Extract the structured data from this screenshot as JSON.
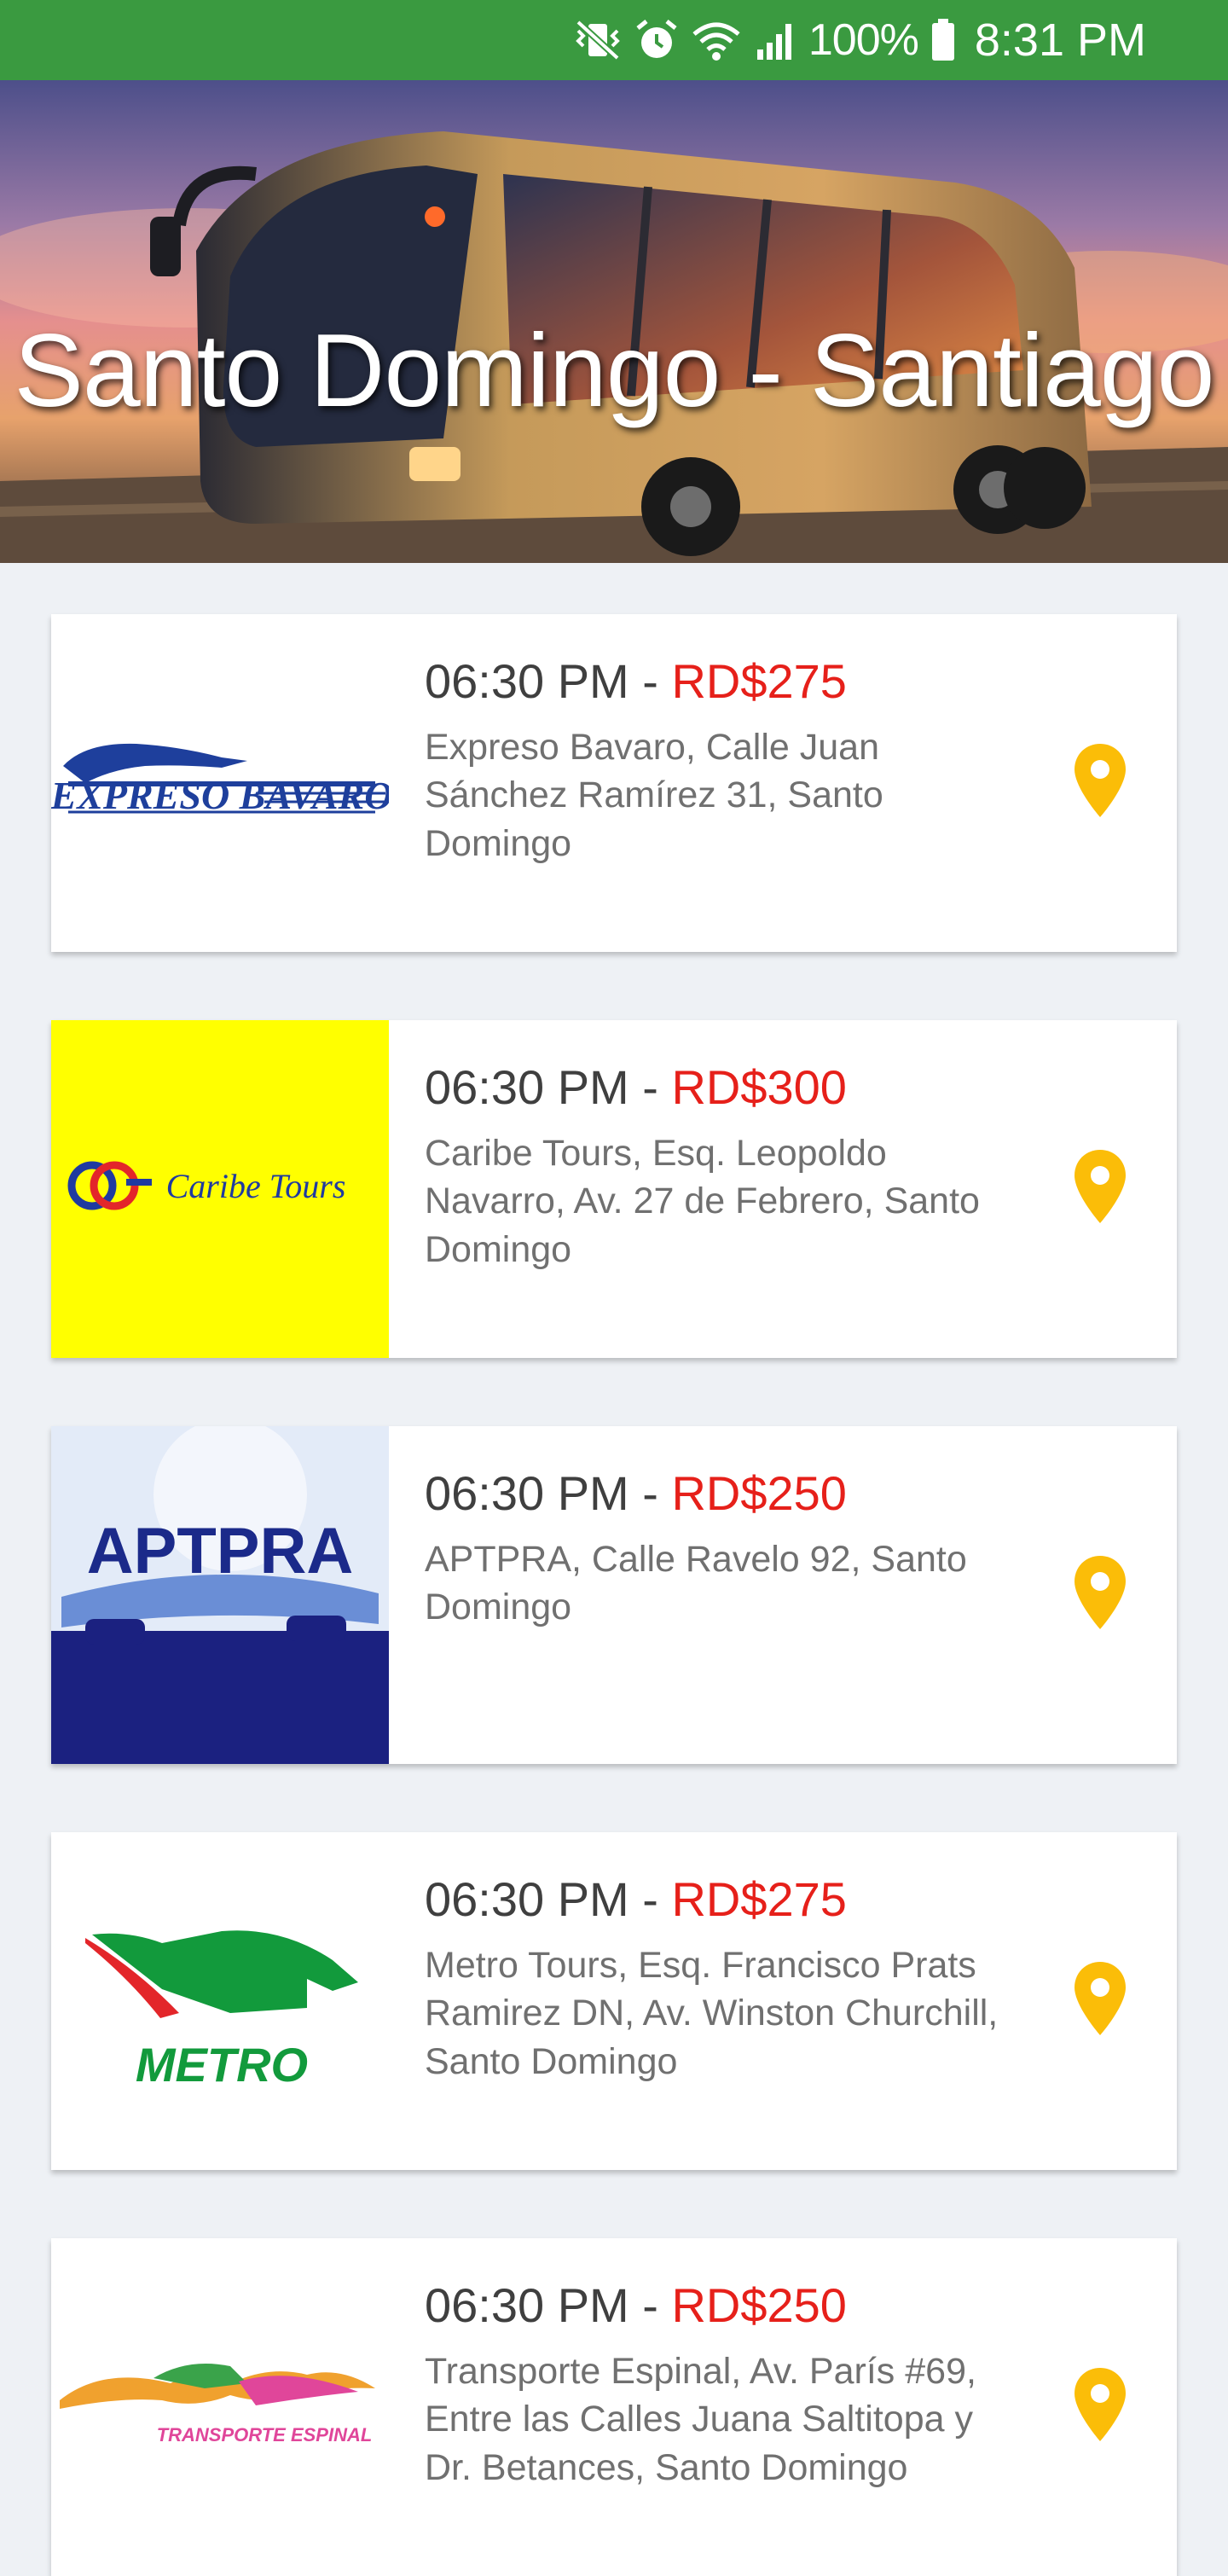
{
  "status_bar": {
    "battery": "100%",
    "time": "8:31 PM",
    "icons": [
      "mute-vibrate-icon",
      "alarm-icon",
      "wifi-icon",
      "signal-icon",
      "battery-icon"
    ]
  },
  "header": {
    "title": "Santo Domingo - Santiago"
  },
  "colors": {
    "status_bar": "#3a9a40",
    "price": "#e6201a",
    "pin": "#fbbd08",
    "background": "#eef1f5"
  },
  "routes": [
    {
      "time": "06:30 PM",
      "separator": " - ",
      "price": "RD$275",
      "address": "Expreso Bavaro, Calle Juan Sánchez Ramírez 31, Santo Domingo",
      "logo_text": "EXPRESO BAVARO"
    },
    {
      "time": "06:30 PM",
      "separator": " - ",
      "price": "RD$300",
      "address": "Caribe Tours, Esq. Leopoldo Navarro, Av. 27 de Febrero, Santo Domingo",
      "logo_text": "Caribe Tours"
    },
    {
      "time": "06:30 PM",
      "separator": " - ",
      "price": "RD$250",
      "address": "APTPRA, Calle Ravelo 92, Santo Domingo",
      "logo_text": "APTPRA"
    },
    {
      "time": "06:30 PM",
      "separator": " - ",
      "price": "RD$275",
      "address": "Metro Tours, Esq. Francisco Prats Ramirez DN, Av. Winston Churchill, Santo Domingo",
      "logo_text": "METRO"
    },
    {
      "time": "06:30 PM",
      "separator": " - ",
      "price": "RD$250",
      "address": "Transporte Espinal, Av. París #69, Entre las Calles Juana Saltitopa y Dr. Betances, Santo Domingo",
      "logo_text": "TRANSPORTE ESPINAL"
    }
  ]
}
